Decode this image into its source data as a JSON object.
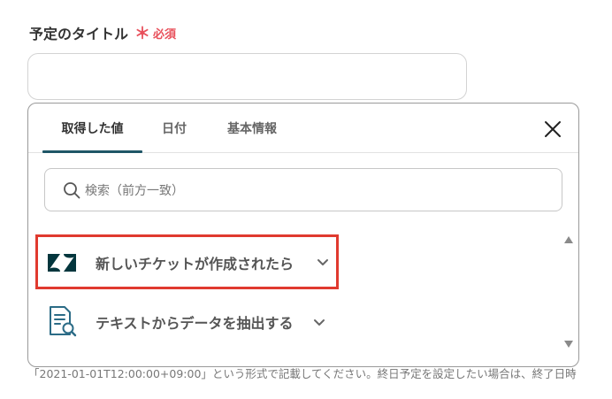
{
  "field": {
    "label": "予定のタイトル",
    "required_star": "＊",
    "required_text": "必須",
    "input_value": ""
  },
  "helper_text": "「2021-01-01T12:00:00+09:00」という形式で記載してください。終日予定を設定したい場合は、終了日時",
  "popup": {
    "tabs": [
      {
        "label": "取得した値",
        "active": true
      },
      {
        "label": "日付",
        "active": false
      },
      {
        "label": "基本情報",
        "active": false
      }
    ],
    "close_icon": "close-icon",
    "search": {
      "placeholder": "検索（前方一致）",
      "icon": "search-icon"
    },
    "items": [
      {
        "label": "新しいチケットが作成されたら",
        "icon": "zendesk-logo-icon",
        "highlighted": true
      },
      {
        "label": "テキストからデータを抽出する",
        "icon": "document-search-icon",
        "highlighted": false
      }
    ]
  },
  "colors": {
    "accent": "#1f5667",
    "required": "#e8505b",
    "highlight": "#e03a2f",
    "zendesk": "#03363d",
    "doc_icon": "#2b6b86"
  }
}
